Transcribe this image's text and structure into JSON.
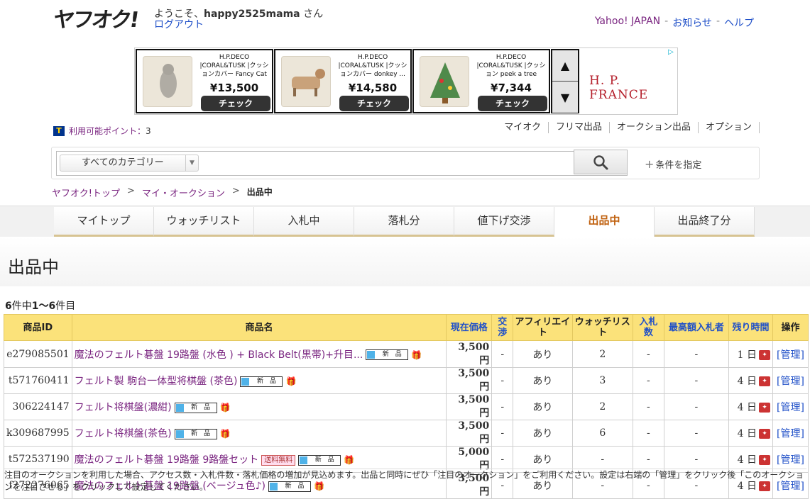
{
  "header": {
    "logo": "ヤフオク!",
    "welcome_prefix": "ようこそ、",
    "username": "happy2525mama",
    "welcome_suffix": " さん",
    "logout": "ログアウト",
    "links": [
      {
        "label": "Yahoo! JAPAN"
      },
      {
        "label": "お知らせ"
      },
      {
        "label": "ヘルプ"
      }
    ],
    "link_sep": "-"
  },
  "ad": {
    "items": [
      {
        "title": "H.P.DECO |CORAL&TUSK |クッションカバー Fancy Cat",
        "price": "¥13,500",
        "button": "チェック"
      },
      {
        "title": "H.P.DECO |CORAL&TUSK |クッションカバー donkey ...",
        "price": "¥14,580",
        "button": "チェック"
      },
      {
        "title": "H.P.DECO |CORAL&TUSK |クッション peek a tree",
        "price": "¥7,344",
        "button": "チェック"
      }
    ],
    "brand": "H. P. FRANCE",
    "up": "▲",
    "down": "▼"
  },
  "points": {
    "label": "利用可能ポイント：",
    "value": "3",
    "icon": "T"
  },
  "mainnav": [
    "マイオク",
    "フリマ出品",
    "オークション出品",
    "オプション"
  ],
  "search": {
    "category": "すべてのカテゴリー",
    "placeholder": "",
    "cond": "条件を指定"
  },
  "breadcrumb": {
    "items": [
      "ヤフオク!トップ",
      "マイ・オークション"
    ],
    "sep": ">",
    "current": "出品中"
  },
  "tabs": [
    {
      "label": "マイトップ"
    },
    {
      "label": "ウォッチリスト"
    },
    {
      "label": "入札中"
    },
    {
      "label": "落札分"
    },
    {
      "label": "値下げ交渉"
    },
    {
      "label": "出品中"
    },
    {
      "label": "出品終了分"
    }
  ],
  "page": {
    "title": "出品中",
    "count_total": "6",
    "count_mid": "件中",
    "count_range": "1〜6",
    "count_suffix": "件目"
  },
  "table": {
    "headers": {
      "id": "商品ID",
      "name": "商品名",
      "price": "現在価格",
      "negotiation": "交渉",
      "affiliate": "アフィリエイト",
      "watch": "ウォッチリスト",
      "bids": "入札数",
      "top_bidder": "最高額入札者",
      "remaining": "残り時間",
      "action": "操作"
    },
    "new_badge": "新　品",
    "ship_badge": "送料無料",
    "rows": [
      {
        "id": "e279085501",
        "name": "魔法のフェルト碁盤 19路盤 (水色 ) + Black Belt(黒帯)+升目...",
        "free_ship": false,
        "price": "3,500 円",
        "negotiation": "-",
        "affiliate": "あり",
        "watch": "2",
        "bids": "-",
        "top_bidder": "-",
        "remaining": "1 日",
        "action": "[管理]"
      },
      {
        "id": "t571760411",
        "name": "フェルト製 駒台一体型将棋盤 (茶色)",
        "free_ship": false,
        "price": "3,500 円",
        "negotiation": "-",
        "affiliate": "あり",
        "watch": "3",
        "bids": "-",
        "top_bidder": "-",
        "remaining": "4 日",
        "action": "[管理]"
      },
      {
        "id": "306224147",
        "name": "フェルト将棋盤(濃紺)",
        "free_ship": false,
        "price": "3,500 円",
        "negotiation": "-",
        "affiliate": "あり",
        "watch": "2",
        "bids": "-",
        "top_bidder": "-",
        "remaining": "4 日",
        "action": "[管理]"
      },
      {
        "id": "k309687995",
        "name": "フェルト将棋盤(茶色)",
        "free_ship": false,
        "price": "3,500 円",
        "negotiation": "-",
        "affiliate": "あり",
        "watch": "6",
        "bids": "-",
        "top_bidder": "-",
        "remaining": "4 日",
        "action": "[管理]"
      },
      {
        "id": "t572537190",
        "name": "魔法のフェルト碁盤 19路盤 9路盤セット",
        "free_ship": true,
        "price": "5,000 円",
        "negotiation": "-",
        "affiliate": "あり",
        "watch": "-",
        "bids": "-",
        "top_bidder": "-",
        "remaining": "4 日",
        "action": "[管理]"
      },
      {
        "id": "f272276065",
        "name": "魔法のフェルト碁盤 19路盤 (ベージュ色♪)",
        "free_ship": false,
        "price": "3,500 円",
        "negotiation": "-",
        "affiliate": "あり",
        "watch": "-",
        "bids": "-",
        "top_bidder": "-",
        "remaining": "4 日",
        "action": "[管理]"
      }
    ]
  },
  "footnote": "注目のオークションを利用した場合、アクセス数・入札件数・落札価格の増加が見込めます。出品と同時にぜひ「注目のオークション」をご利用ください。設定は右端の「管理」をクリック後「このオークションを注目させる」をクリックして設定してください。",
  "colors": {
    "link_purple": "#7a2580",
    "link_blue": "#2050c8",
    "header_yellow": "#fbe27a",
    "tab_active": "#c0610f"
  }
}
